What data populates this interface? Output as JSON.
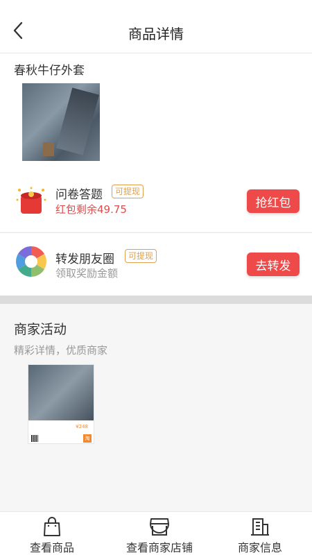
{
  "header": {
    "title": "商品详情",
    "back_icon": "chevron-left-icon"
  },
  "product": {
    "name": "春秋牛仔外套"
  },
  "tasks": [
    {
      "title": "问卷答题",
      "badge": "可提现",
      "subtitle": "红包剩余49.75",
      "button": "抢红包",
      "icon": "red-envelope-icon"
    },
    {
      "title": "转发朋友圈",
      "badge": "可提现",
      "subtitle": "领取奖励金额",
      "button": "去转发",
      "icon": "moments-shutter-icon"
    }
  ],
  "merchant": {
    "title": "商家活动",
    "subtitle": "精彩详情，优质商家",
    "poster": {
      "price": "¥248",
      "logo": "淘"
    }
  },
  "bottom_nav": [
    {
      "label": "查看商品",
      "icon": "shopping-bag-icon"
    },
    {
      "label": "查看商家店铺",
      "icon": "storefront-icon"
    },
    {
      "label": "商家信息",
      "icon": "building-icon"
    }
  ],
  "colors": {
    "accent_red": "#ef4a4a",
    "badge_orange": "#e0a050",
    "price_orange": "#ef8a2f"
  }
}
